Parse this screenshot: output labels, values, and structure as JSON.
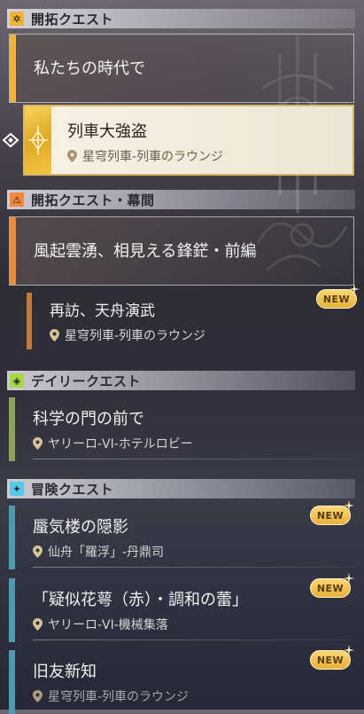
{
  "sections": [
    {
      "title": "開拓クエスト",
      "icon": "trailblaze-quest-icon",
      "color": "#f0b33a"
    },
    {
      "title": "開拓クエスト・幕間",
      "icon": "interlude-quest-icon",
      "color": "#f08a3a"
    },
    {
      "title": "デイリークエスト",
      "icon": "daily-quest-icon",
      "color": "#a8d848"
    },
    {
      "title": "冒険クエスト",
      "icon": "adventure-quest-icon",
      "color": "#58c8e8"
    }
  ],
  "trailblaze": {
    "chapter": "私たちの時代で",
    "current": {
      "title": "列車大強盗",
      "location": "星穹列車-列車のラウンジ"
    }
  },
  "interlude": {
    "chapter": "風起雲湧、相見える鋒鋩・前編",
    "current": {
      "title": "再訪、天舟演武",
      "location": "星穹列車-列車のラウンジ",
      "badge": "NEW"
    }
  },
  "daily": [
    {
      "title": "科学の門の前で",
      "location": "ヤリーロ-VI-ホテルロビー"
    }
  ],
  "adventure": [
    {
      "title": "蜃気楼の隠影",
      "location": "仙舟「羅浮」-丹鼎司",
      "badge": "NEW"
    },
    {
      "title": "「疑似花萼（赤）・調和の蕾」",
      "location": "ヤリーロ-VI-機械集落",
      "badge": "NEW"
    },
    {
      "title": "旧友新知",
      "location": "星穹列車-列車のラウンジ",
      "badge": "NEW"
    }
  ]
}
